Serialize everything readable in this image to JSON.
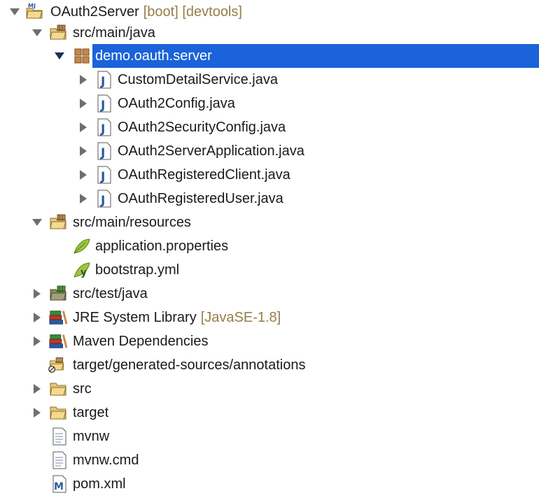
{
  "tree": {
    "project": {
      "label": "OAuth2Server",
      "decorations": "[boot] [devtools]"
    },
    "src_main_java": {
      "label": "src/main/java"
    },
    "package": {
      "label": "demo.oauth.server"
    },
    "java_files": [
      {
        "label": "CustomDetailService.java"
      },
      {
        "label": "OAuth2Config.java"
      },
      {
        "label": "OAuth2SecurityConfig.java"
      },
      {
        "label": "OAuth2ServerApplication.java"
      },
      {
        "label": "OAuthRegisteredClient.java"
      },
      {
        "label": "OAuthRegisteredUser.java"
      }
    ],
    "src_main_resources": {
      "label": "src/main/resources"
    },
    "resources": [
      {
        "label": "application.properties",
        "icon": "properties-leaf-icon"
      },
      {
        "label": "bootstrap.yml",
        "icon": "yaml-leaf-icon"
      }
    ],
    "src_test_java": {
      "label": "src/test/java"
    },
    "jre": {
      "label": "JRE System Library",
      "decorations": "[JavaSE-1.8]"
    },
    "maven": {
      "label": "Maven Dependencies"
    },
    "generated": {
      "label": "target/generated-sources/annotations"
    },
    "folders": [
      {
        "label": "src"
      },
      {
        "label": "target"
      }
    ],
    "files": [
      {
        "label": "mvnw",
        "icon": "text-file-icon"
      },
      {
        "label": "mvnw.cmd",
        "icon": "text-file-icon"
      },
      {
        "label": "pom.xml",
        "icon": "maven-pom-icon"
      }
    ]
  },
  "colors": {
    "selection": "#1a63d8",
    "decoration": "#957d47",
    "twisty": "#6e6e6e",
    "java_icon": "#2b5aa0",
    "folder": "#e8c777"
  }
}
